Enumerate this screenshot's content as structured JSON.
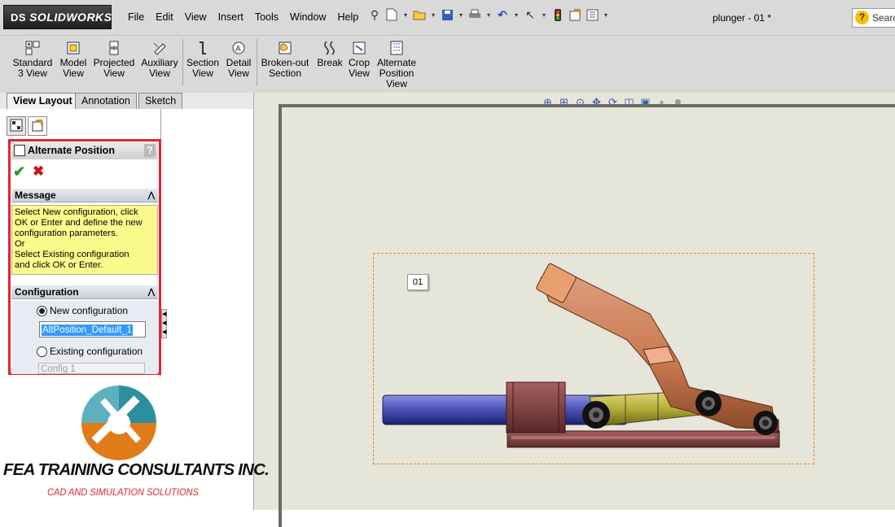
{
  "app": {
    "logo_prefix": "DS",
    "logo_text": "SOLIDWORKS",
    "document_title": "plunger - 01 *",
    "search_placeholder": "Search"
  },
  "menu": [
    "File",
    "Edit",
    "View",
    "Insert",
    "Tools",
    "Window",
    "Help"
  ],
  "command_manager": {
    "tools": [
      {
        "label1": "Standard",
        "label2": "3 View"
      },
      {
        "label1": "Model",
        "label2": "View"
      },
      {
        "label1": "Projected",
        "label2": "View"
      },
      {
        "label1": "Auxiliary",
        "label2": "View"
      },
      {
        "label1": "Section",
        "label2": "View"
      },
      {
        "label1": "Detail",
        "label2": "View"
      },
      {
        "label1": "Broken-out",
        "label2": "Section"
      },
      {
        "label1": "Break",
        "label2": ""
      },
      {
        "label1": "Crop",
        "label2": "View"
      },
      {
        "label1": "Alternate",
        "label2": "Position",
        "label3": "View"
      }
    ]
  },
  "tabs": [
    "View Layout",
    "Annotation",
    "Sketch"
  ],
  "property_manager": {
    "title": "Alternate Position",
    "help": "?",
    "ok": "✔",
    "cancel": "✖",
    "message_header": "Message",
    "message_lines": [
      "Select New configuration, click",
      "OK or Enter and define the new",
      "configuration parameters.",
      "Or",
      "Select Existing configuration",
      "and click OK or Enter."
    ],
    "configuration_header": "Configuration",
    "new_configuration_label": "New configuration",
    "new_configuration_value": "AltPosition_Default_1",
    "existing_configuration_label": "Existing configuration",
    "existing_configuration_value": "Config 1"
  },
  "drawing": {
    "view_label": "01"
  },
  "watermark": {
    "title": "FEA TRAINING  CONSULTANTS INC.",
    "subtitle": "CAD AND SIMULATION SOLUTIONS"
  },
  "colors": {
    "toolbar_bg": "#d9d9d9",
    "canvas_bg": "#e6e5d9",
    "highlight_border": "#e3242b",
    "message_bg": "#fbfb8c",
    "view_box_border": "#f08a1c",
    "link_color": "#c87850",
    "rod_color": "#4a4fb5",
    "base_color": "#7a3e3e",
    "yellow_link": "#b5ae3a"
  }
}
